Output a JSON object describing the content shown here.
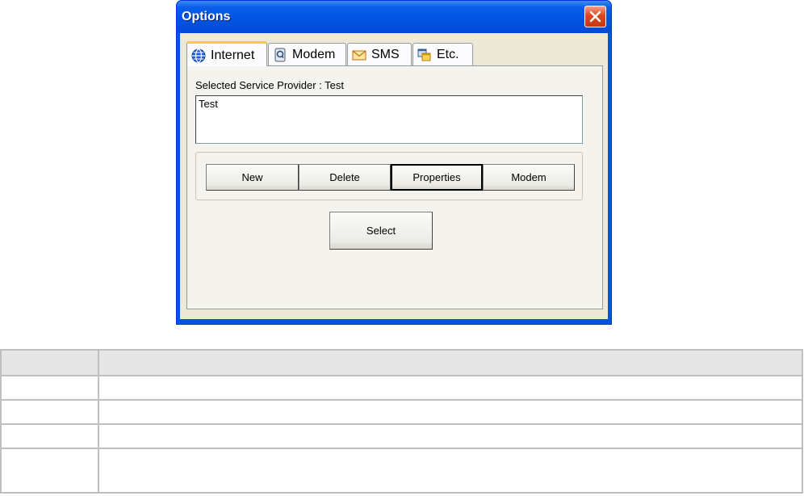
{
  "window": {
    "title": "Options"
  },
  "tabs": [
    {
      "label": "Internet",
      "icon": "globe-icon",
      "active": true
    },
    {
      "label": "Modem",
      "icon": "modem-icon",
      "active": false
    },
    {
      "label": "SMS",
      "icon": "envelope-icon",
      "active": false
    },
    {
      "label": "Etc.",
      "icon": "windows-icon",
      "active": false
    }
  ],
  "provider": {
    "label": "Selected Service Provider : Test",
    "items": [
      "Test"
    ]
  },
  "buttons": {
    "new": "New",
    "delete": "Delete",
    "properties": "Properties",
    "modem": "Modem",
    "select": "Select"
  },
  "table": {
    "header": [
      "",
      ""
    ],
    "rows": [
      [
        "",
        ""
      ],
      [
        "",
        ""
      ],
      [
        "",
        ""
      ],
      [
        "",
        ""
      ]
    ]
  },
  "colors": {
    "titlebar": "#0054e3",
    "dialog_bg": "#ece9d8",
    "close_button": "#e0461c",
    "tab_highlight": "#ffc83c"
  }
}
